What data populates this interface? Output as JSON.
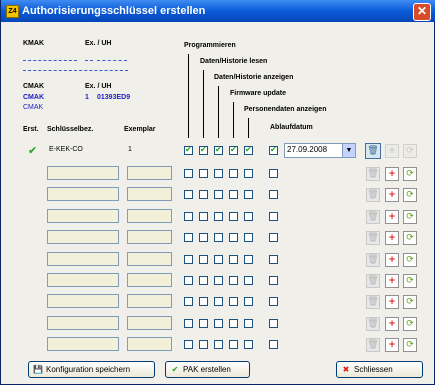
{
  "window": {
    "title": "Authorisierungsschlüssel erstellen",
    "app_icon": "Z4"
  },
  "header": {
    "kmak_label": "KMAK",
    "kmak_ex_label": "Ex. / UH",
    "cmak_label": "CMAK",
    "cmak_ex_label": "Ex. / UH",
    "cmak_value": "CMAK",
    "cmak_ex_value": "1",
    "cmak_uh_value": "01393ED9",
    "cmak_sub": "CMAK"
  },
  "permissions": {
    "programmieren": "Programmieren",
    "historie_lesen": "Daten/Historie lesen",
    "historie_anzeigen": "Daten/Historie anzeigen",
    "firmware": "Firmware update",
    "personendaten": "Personendaten anzeigen",
    "ablaufdatum": "Ablaufdatum"
  },
  "columns": {
    "erst": "Erst.",
    "schluessel": "Schlüsselbez.",
    "exemplar": "Exemplar"
  },
  "rows": [
    {
      "name": "E-KEK-CO",
      "exemplar": "1",
      "created": true,
      "checks": [
        true,
        true,
        true,
        true,
        true
      ],
      "expiry_enabled": true,
      "date": "27.09.2008"
    },
    {
      "name": "",
      "exemplar": "",
      "created": false,
      "checks": [
        false,
        false,
        false,
        false,
        false
      ],
      "expiry_enabled": false,
      "date": ""
    },
    {
      "name": "",
      "exemplar": "",
      "created": false,
      "checks": [
        false,
        false,
        false,
        false,
        false
      ],
      "expiry_enabled": false,
      "date": ""
    },
    {
      "name": "",
      "exemplar": "",
      "created": false,
      "checks": [
        false,
        false,
        false,
        false,
        false
      ],
      "expiry_enabled": false,
      "date": ""
    },
    {
      "name": "",
      "exemplar": "",
      "created": false,
      "checks": [
        false,
        false,
        false,
        false,
        false
      ],
      "expiry_enabled": false,
      "date": ""
    },
    {
      "name": "",
      "exemplar": "",
      "created": false,
      "checks": [
        false,
        false,
        false,
        false,
        false
      ],
      "expiry_enabled": false,
      "date": ""
    },
    {
      "name": "",
      "exemplar": "",
      "created": false,
      "checks": [
        false,
        false,
        false,
        false,
        false
      ],
      "expiry_enabled": false,
      "date": ""
    },
    {
      "name": "",
      "exemplar": "",
      "created": false,
      "checks": [
        false,
        false,
        false,
        false,
        false
      ],
      "expiry_enabled": false,
      "date": ""
    },
    {
      "name": "",
      "exemplar": "",
      "created": false,
      "checks": [
        false,
        false,
        false,
        false,
        false
      ],
      "expiry_enabled": false,
      "date": ""
    },
    {
      "name": "",
      "exemplar": "",
      "created": false,
      "checks": [
        false,
        false,
        false,
        false,
        false
      ],
      "expiry_enabled": false,
      "date": ""
    }
  ],
  "footer": {
    "save_label": "Konfiguration speichern",
    "create_label": "PAK erstellen",
    "close_label": "Schliessen"
  },
  "icons": {
    "trash": "trash-icon",
    "plus": "plus-icon",
    "refresh": "refresh-icon",
    "check": "checkmark-icon",
    "save": "floppy-icon",
    "close": "x-icon"
  },
  "colors": {
    "accent": "#1f20c8",
    "titlebar": "#0a5bd8",
    "check": "#21a121",
    "close": "#e01a1a"
  }
}
